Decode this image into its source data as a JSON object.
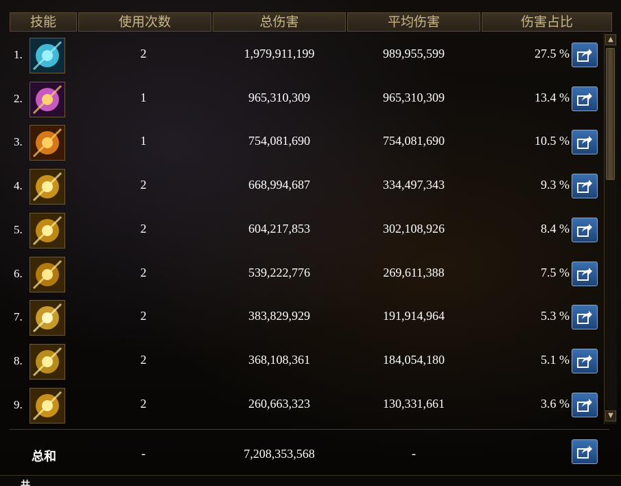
{
  "header": {
    "skill": "技能",
    "uses": "使用次数",
    "total_damage": "总伤害",
    "avg_damage": "平均伤害",
    "damage_share": "伤害占比"
  },
  "rows": [
    {
      "index": "1.",
      "icon": "blue-orb-skill-icon",
      "uses": "2",
      "total": "1,979,911,199",
      "avg": "989,955,599",
      "pct": "27.5 %"
    },
    {
      "index": "2.",
      "icon": "pink-burst-skill-icon",
      "uses": "1",
      "total": "965,310,309",
      "avg": "965,310,309",
      "pct": "13.4 %"
    },
    {
      "index": "3.",
      "icon": "fire-swirl-skill-icon",
      "uses": "1",
      "total": "754,081,690",
      "avg": "754,081,690",
      "pct": "10.5 %"
    },
    {
      "index": "4.",
      "icon": "golden-eye-skill-icon",
      "uses": "2",
      "total": "668,994,687",
      "avg": "334,497,343",
      "pct": "9.3 %"
    },
    {
      "index": "5.",
      "icon": "golden-slash-skill-icon",
      "uses": "2",
      "total": "604,217,853",
      "avg": "302,108,926",
      "pct": "8.4 %"
    },
    {
      "index": "6.",
      "icon": "golden-strike-skill-icon",
      "uses": "2",
      "total": "539,222,776",
      "avg": "269,611,388",
      "pct": "7.5 %"
    },
    {
      "index": "7.",
      "icon": "golden-star-skill-icon",
      "uses": "2",
      "total": "383,829,929",
      "avg": "191,914,964",
      "pct": "5.3 %"
    },
    {
      "index": "8.",
      "icon": "golden-spiral-skill-icon",
      "uses": "2",
      "total": "368,108,361",
      "avg": "184,054,180",
      "pct": "5.1 %"
    },
    {
      "index": "9.",
      "icon": "golden-spark-skill-icon",
      "uses": "2",
      "total": "260,663,323",
      "avg": "130,331,661",
      "pct": "3.6 %"
    }
  ],
  "totals": {
    "label": "总和",
    "uses": "-",
    "total": "7,208,353,568",
    "avg": "-"
  },
  "footer": {
    "label": "共"
  },
  "colors": {
    "header_text": "#c9b68a",
    "button_blue": "#2d5f9e",
    "icon_gold": "#e0a520"
  }
}
